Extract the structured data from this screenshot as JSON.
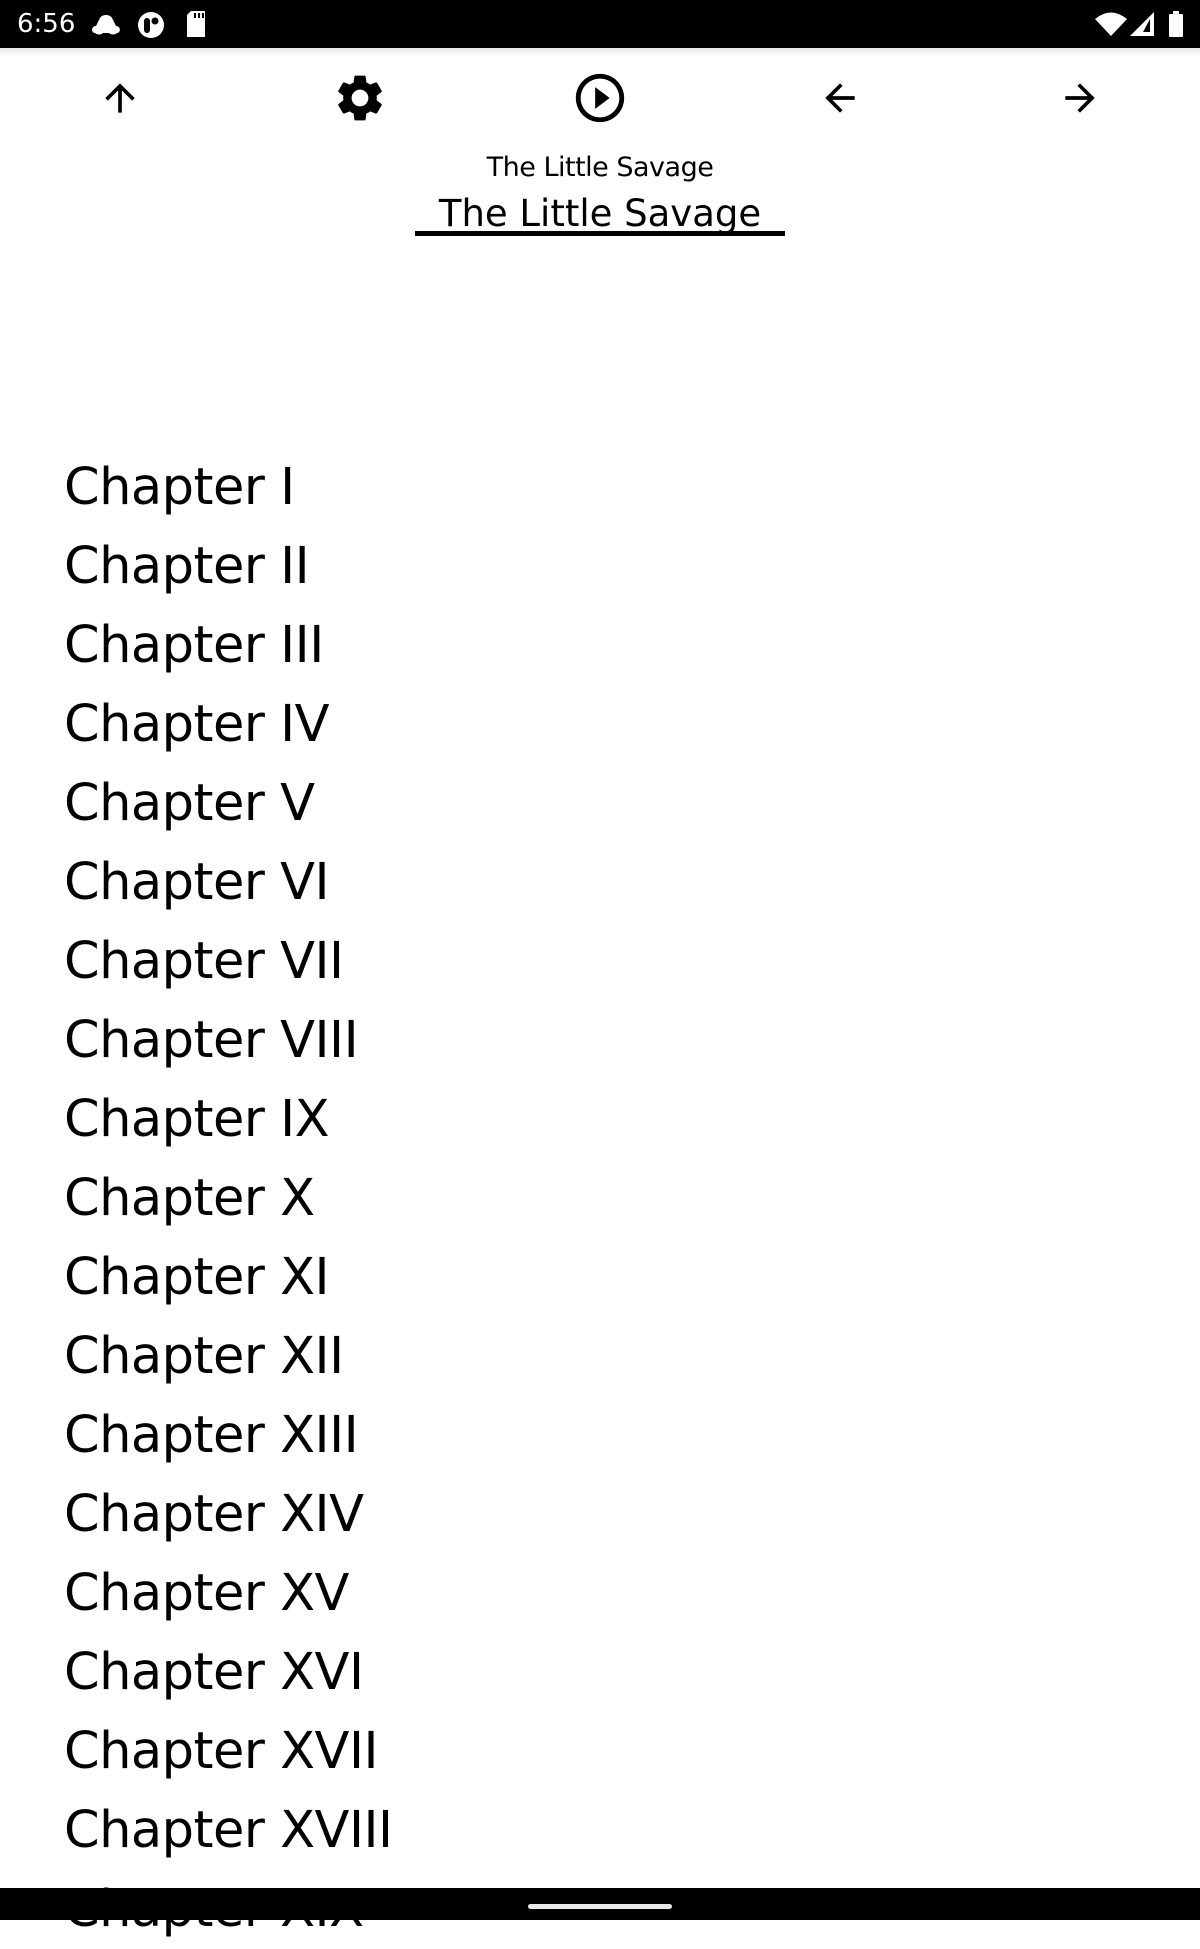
{
  "status_bar": {
    "time": "6:56",
    "left_icons": [
      "cloud-icon",
      "app-notification-icon",
      "sd-card-icon"
    ],
    "right_icons": [
      "wifi-icon",
      "cell-signal-icon",
      "battery-icon"
    ]
  },
  "toolbar": {
    "buttons": [
      {
        "name": "up",
        "icon": "arrow-up-icon"
      },
      {
        "name": "settings",
        "icon": "gear-icon"
      },
      {
        "name": "play",
        "icon": "play-circle-icon"
      },
      {
        "name": "previous",
        "icon": "arrow-left-icon"
      },
      {
        "name": "next",
        "icon": "arrow-right-icon"
      }
    ]
  },
  "book": {
    "subtitle": "The Little Savage",
    "title_field_value": "The Little Savage"
  },
  "chapters": [
    "Chapter I",
    "Chapter II",
    "Chapter III",
    "Chapter IV",
    "Chapter V",
    "Chapter VI",
    "Chapter VII",
    "Chapter VIII",
    "Chapter IX",
    "Chapter X",
    "Chapter XI",
    "Chapter XII",
    "Chapter XIII",
    "Chapter XIV",
    "Chapter XV",
    "Chapter XVI",
    "Chapter XVII",
    "Chapter XVIII",
    "Chapter XIX"
  ]
}
